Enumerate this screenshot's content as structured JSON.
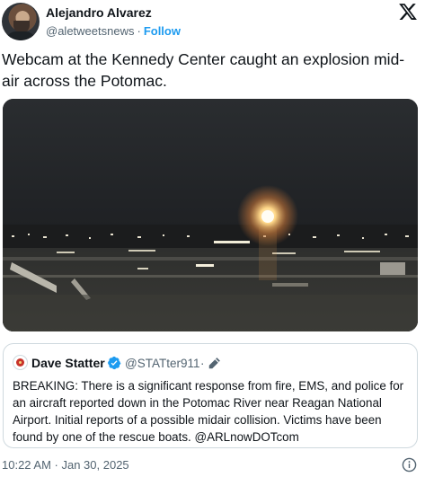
{
  "author": {
    "name": "Alejandro Alvarez",
    "handle": "@aletweetsnews",
    "separator": "·",
    "follow_label": "Follow"
  },
  "tweet": {
    "text": "Webcam at the Kennedy Center caught an explosion mid-air across the Potomac."
  },
  "media": {
    "kind": "video-still",
    "description_icon": "webcam-night-river-image"
  },
  "quoted_tweet": {
    "name": "Dave Statter",
    "handle": "@STATter911",
    "separator": "·",
    "text": "BREAKING: There is a significant response from fire, EMS, and police  for an aircraft reported down in the Potomac River near Reagan National Airport. Initial reports of a possible midair collision. Victims have been found by one of the rescue boats. @ARLnowDOTcom"
  },
  "footer": {
    "timestamp": "10:22 AM · Jan 30, 2025"
  },
  "colors": {
    "accent": "#1d9bf0",
    "muted_text": "#536471",
    "border": "#cfd9de"
  },
  "icons": [
    "x-logo-icon",
    "verified-badge-icon",
    "pencil-edit-icon",
    "info-icon"
  ]
}
